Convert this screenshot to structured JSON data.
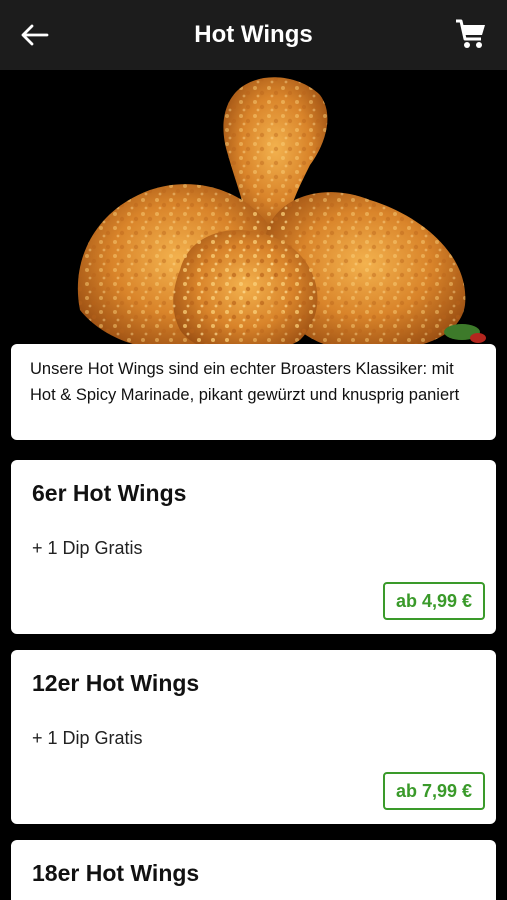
{
  "header": {
    "title": "Hot Wings",
    "back_icon": "arrow-left-icon",
    "cart_icon": "shopping-cart-icon"
  },
  "description": "Unsere Hot Wings sind ein echter Broasters Klassiker: mit Hot & Spicy Marinade, pikant gewürzt und knusprig paniert",
  "products": [
    {
      "name": "6er Hot Wings",
      "subtitle": "+ 1 Dip Gratis",
      "price": "ab 4,99 €"
    },
    {
      "name": "12er Hot Wings",
      "subtitle": "+ 1 Dip Gratis",
      "price": "ab 7,99 €"
    },
    {
      "name": "18er Hot Wings",
      "subtitle": "",
      "price": ""
    }
  ],
  "colors": {
    "header_bg": "#1c1c1c",
    "accent_green": "#3a9a2a",
    "page_bg": "#000000"
  }
}
